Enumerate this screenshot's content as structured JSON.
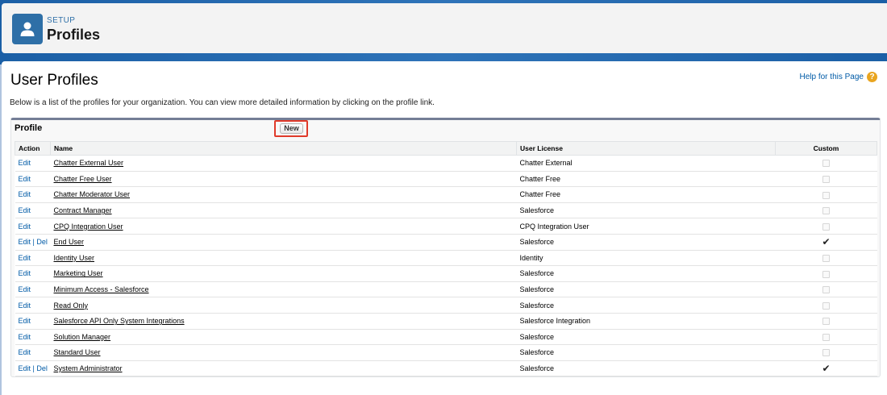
{
  "header": {
    "section": "SETUP",
    "title": "Profiles"
  },
  "page": {
    "title": "User Profiles",
    "help_link": "Help for this Page",
    "description": "Below is a list of the profiles for your organization. You can view more detailed information by clicking on the profile link."
  },
  "list": {
    "title": "Profile",
    "new_button": "New",
    "columns": {
      "action": "Action",
      "name": "Name",
      "license": "User License",
      "custom": "Custom"
    },
    "edit_label": "Edit",
    "del_label": "Del",
    "rows": [
      {
        "name": "Chatter External User",
        "license": "Chatter External",
        "custom": false,
        "deletable": false
      },
      {
        "name": "Chatter Free User",
        "license": "Chatter Free",
        "custom": false,
        "deletable": false
      },
      {
        "name": "Chatter Moderator User",
        "license": "Chatter Free",
        "custom": false,
        "deletable": false
      },
      {
        "name": "Contract Manager",
        "license": "Salesforce",
        "custom": false,
        "deletable": false
      },
      {
        "name": "CPQ Integration User",
        "license": "CPQ Integration User",
        "custom": false,
        "deletable": false
      },
      {
        "name": "End User",
        "license": "Salesforce",
        "custom": true,
        "deletable": true
      },
      {
        "name": "Identity User",
        "license": "Identity",
        "custom": false,
        "deletable": false
      },
      {
        "name": "Marketing User",
        "license": "Salesforce",
        "custom": false,
        "deletable": false
      },
      {
        "name": "Minimum Access - Salesforce",
        "license": "Salesforce",
        "custom": false,
        "deletable": false
      },
      {
        "name": "Read Only",
        "license": "Salesforce",
        "custom": false,
        "deletable": false
      },
      {
        "name": "Salesforce API Only System Integrations",
        "license": "Salesforce Integration",
        "custom": false,
        "deletable": false
      },
      {
        "name": "Solution Manager",
        "license": "Salesforce",
        "custom": false,
        "deletable": false
      },
      {
        "name": "Standard User",
        "license": "Salesforce",
        "custom": false,
        "deletable": false
      },
      {
        "name": "System Administrator",
        "license": "Salesforce",
        "custom": true,
        "deletable": true
      }
    ]
  },
  "icons": {
    "header": "user-icon",
    "help": "help-icon",
    "custom_true": "checkmark-icon",
    "custom_false": "checkbox-icon"
  },
  "colors": {
    "brand_band": "#1b5fa6",
    "header_icon_bg": "#2e6fa7",
    "link": "#015ba7",
    "highlight": "#e03a2a",
    "help_icon": "#e9a520"
  }
}
